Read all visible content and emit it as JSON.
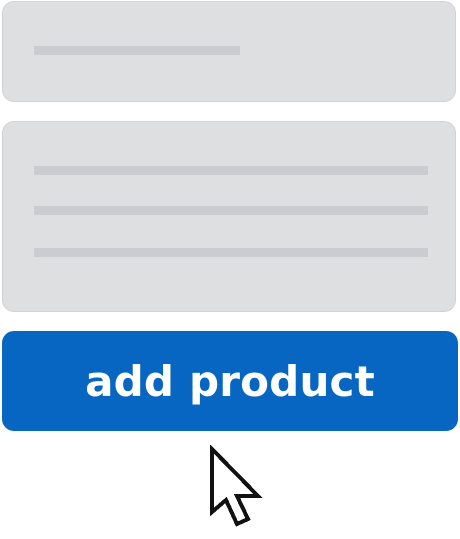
{
  "actions": {
    "add_product_label": "add product"
  },
  "cursor": {
    "type": "arrow-pointer"
  },
  "colors": {
    "accent": "#0866c3",
    "placeholder_card": "#dedfe1",
    "placeholder_line": "#cbcccf"
  }
}
